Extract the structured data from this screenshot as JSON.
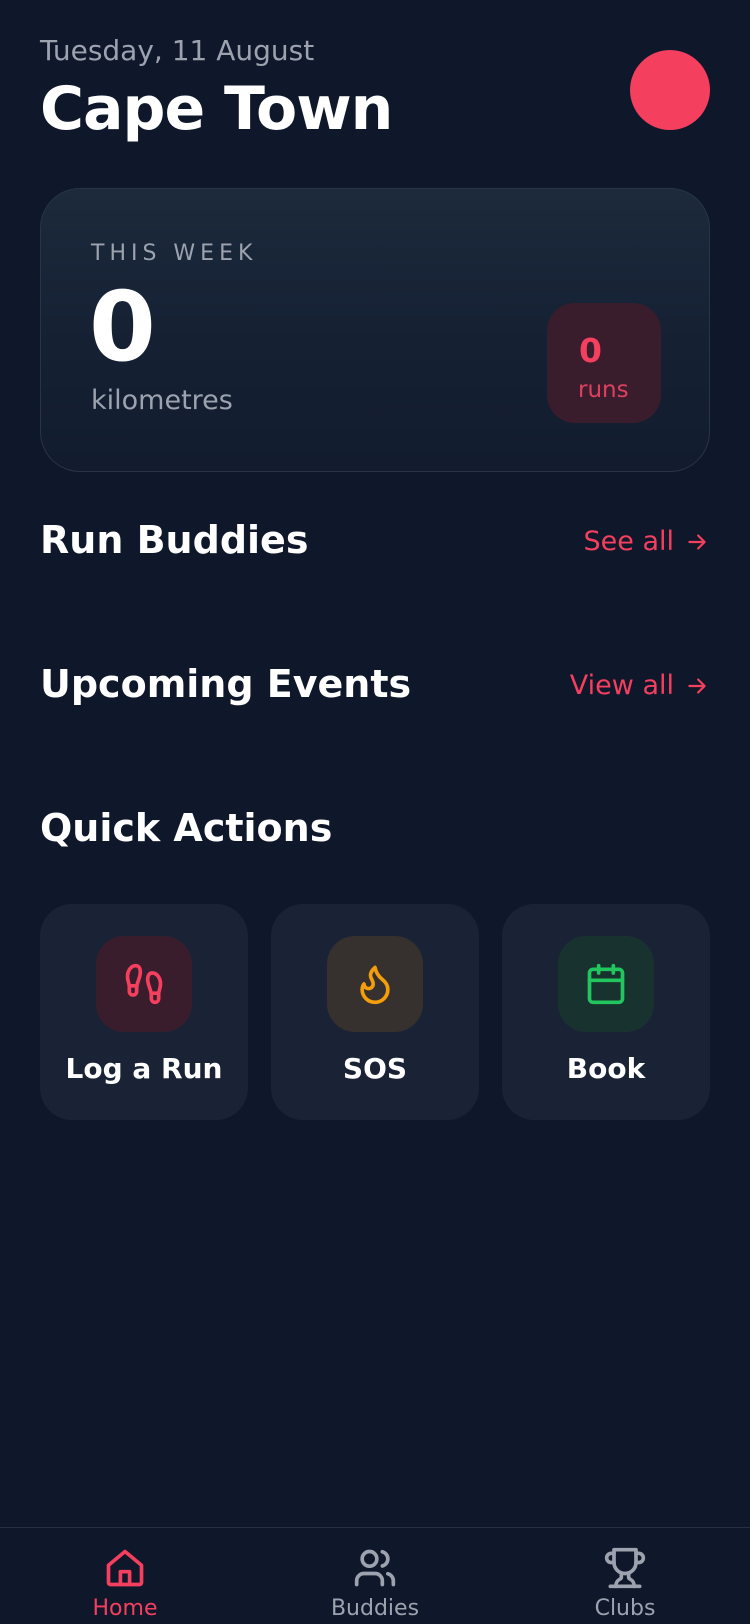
{
  "header": {
    "date": "Tuesday, 11 August",
    "city": "Cape Town"
  },
  "week_summary": {
    "label": "THIS WEEK",
    "distance_value": "0",
    "distance_unit": "kilometres",
    "runs_value": "0",
    "runs_unit": "runs"
  },
  "sections": {
    "buddies": {
      "title": "Run Buddies",
      "link": "See all"
    },
    "events": {
      "title": "Upcoming Events",
      "link": "View all"
    },
    "quick_actions": {
      "title": "Quick Actions"
    }
  },
  "quick_actions": [
    {
      "label": "Log a Run",
      "icon": "footprints-icon",
      "color": "#f43f5e"
    },
    {
      "label": "SOS",
      "icon": "flame-icon",
      "color": "#f59e0b"
    },
    {
      "label": "Book",
      "icon": "calendar-icon",
      "color": "#22c55e"
    }
  ],
  "nav": [
    {
      "label": "Home",
      "icon": "home-icon",
      "active": true
    },
    {
      "label": "Buddies",
      "icon": "users-icon",
      "active": false
    },
    {
      "label": "Clubs",
      "icon": "trophy-icon",
      "active": false
    }
  ],
  "colors": {
    "background": "#0f172a",
    "accent": "#f43f5e",
    "muted": "#9ca3af"
  }
}
